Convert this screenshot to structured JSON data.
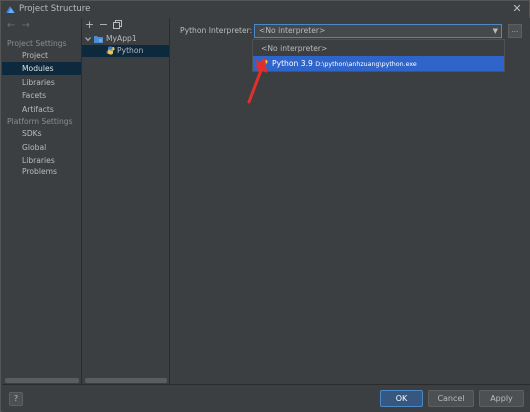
{
  "window": {
    "title": "Project Structure",
    "close_glyph": "✕"
  },
  "sidebar": {
    "back_glyph": "←",
    "forward_glyph": "→",
    "sections": [
      {
        "header": "Project Settings",
        "items": [
          "Project",
          "Modules",
          "Libraries",
          "Facets",
          "Artifacts"
        ]
      },
      {
        "header": "Platform Settings",
        "items": [
          "SDKs",
          "Global Libraries"
        ]
      }
    ],
    "extra_item": "Problems",
    "selected_item": "Modules"
  },
  "tree": {
    "toolbar": {
      "add_glyph": "+",
      "remove_glyph": "−"
    },
    "root": "MyApp1",
    "child": "Python"
  },
  "content": {
    "interpreter_label": "Python Interpreter:",
    "interpreter_value": "<No interpreter>",
    "more_glyph": "...",
    "dropdown": {
      "options": [
        {
          "label": "<No interpreter>",
          "detail": ""
        },
        {
          "label": "Python 3.9",
          "detail": "D:\\python\\anhzuang\\python.exe"
        }
      ],
      "highlighted_index": 1
    }
  },
  "footer": {
    "help_glyph": "?",
    "ok_label": "OK",
    "cancel_label": "Cancel",
    "apply_label": "Apply"
  },
  "colors": {
    "background": "#3c3f41",
    "selection_dark": "#0d293e",
    "selection_bright": "#2f65ca",
    "annotation_arrow": "#e0302b"
  },
  "icons": [
    "app-icon",
    "back-arrow-icon",
    "forward-arrow-icon",
    "add-icon",
    "remove-icon",
    "copy-icon",
    "chevron-down-icon",
    "folder-icon",
    "python-icon",
    "close-icon",
    "help-icon"
  ]
}
